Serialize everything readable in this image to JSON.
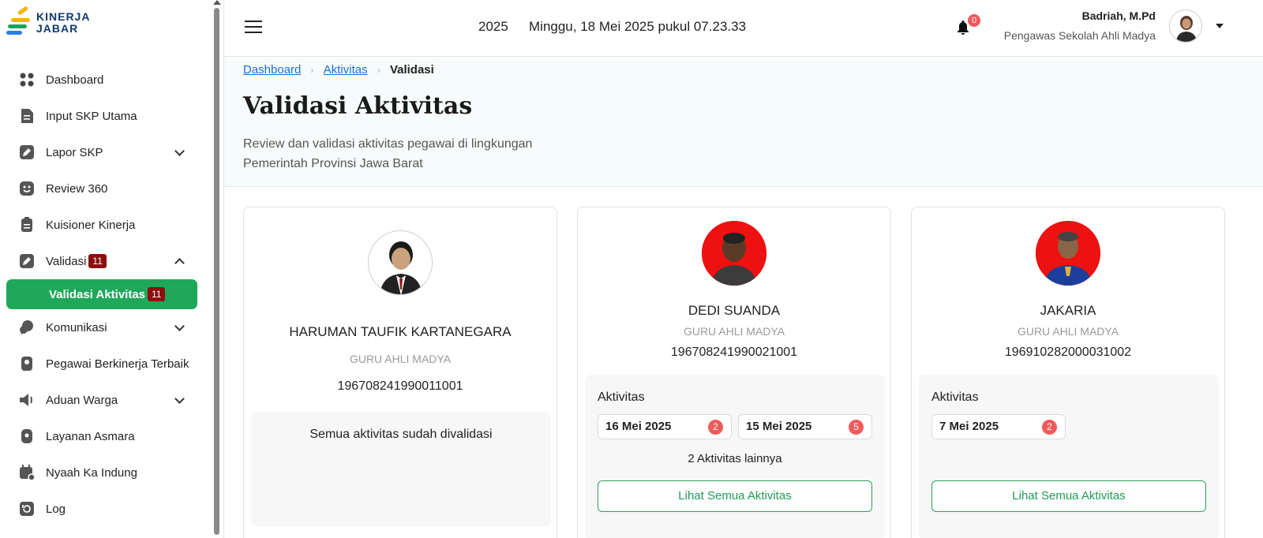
{
  "brand": {
    "line1": "KINERJA",
    "line2": "JABAR"
  },
  "sidebar": {
    "items": [
      {
        "label": "Dashboard"
      },
      {
        "label": "Input SKP Utama"
      },
      {
        "label": "Lapor SKP"
      },
      {
        "label": "Review 360"
      },
      {
        "label": "Kuisioner Kinerja"
      },
      {
        "label": "Validasi",
        "badge": "11"
      },
      {
        "label": "Validasi Aktivitas",
        "badge": "11"
      },
      {
        "label": "Komunikasi"
      },
      {
        "label": "Pegawai Berkinerja Terbaik"
      },
      {
        "label": "Aduan Warga"
      },
      {
        "label": "Layanan Asmara"
      },
      {
        "label": "Nyaah Ka Indung"
      },
      {
        "label": "Log"
      }
    ]
  },
  "header": {
    "year": "2025",
    "datetime": "Minggu, 18 Mei 2025 pukul 07.23.33",
    "notif_count": "0",
    "user_name": "Badriah, M.Pd",
    "user_role": "Pengawas Sekolah Ahli Madya"
  },
  "breadcrumb": {
    "item1": "Dashboard",
    "item2": "Aktivitas",
    "current": "Validasi"
  },
  "page": {
    "title": "Validasi Aktivitas",
    "description": "Review dan validasi aktivitas pegawai di lingkungan Pemerintah Provinsi Jawa Barat"
  },
  "cards": [
    {
      "name": "HARUMAN TAUFIK KARTANEGARA",
      "role": "GURU AHLI MADYA",
      "nip": "196708241990011001",
      "message": "Semua aktivitas sudah divalidasi"
    },
    {
      "name": "DEDI SUANDA",
      "role": "GURU AHLI MADYA",
      "nip": "196708241990021001",
      "activity_label": "Aktivitas",
      "chips": [
        {
          "date": "16 Mei 2025",
          "count": "2"
        },
        {
          "date": "15 Mei 2025",
          "count": "5"
        }
      ],
      "more": "2 Aktivitas lainnya",
      "button": "Lihat Semua Aktivitas"
    },
    {
      "name": "JAKARIA",
      "role": "GURU AHLI MADYA",
      "nip": "196910282000031002",
      "activity_label": "Aktivitas",
      "chips": [
        {
          "date": "7 Mei 2025",
          "count": "2"
        }
      ],
      "button": "Lihat Semua Aktivitas"
    }
  ],
  "colors": {
    "accent_green": "#1fa85a",
    "badge_red": "#8b0f0f",
    "notif_red": "#f0595c",
    "link_blue": "#1a6fd4"
  }
}
